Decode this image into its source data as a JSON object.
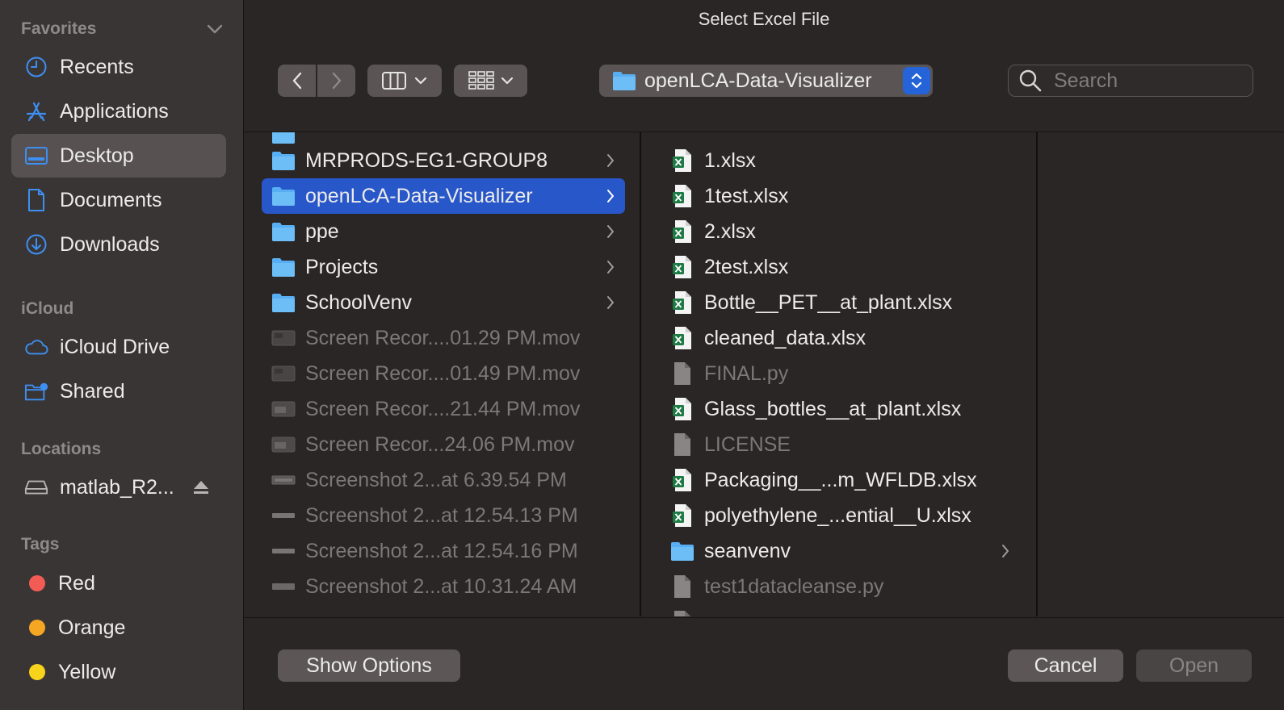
{
  "window": {
    "title": "Select Excel File"
  },
  "sidebar": {
    "sections": {
      "favorites": "Favorites",
      "icloud": "iCloud",
      "locations": "Locations",
      "tags": "Tags"
    },
    "favorites": [
      {
        "label": "Recents",
        "icon": "clock-icon"
      },
      {
        "label": "Applications",
        "icon": "applications-icon"
      },
      {
        "label": "Desktop",
        "icon": "desktop-icon",
        "selected": true
      },
      {
        "label": "Documents",
        "icon": "document-icon"
      },
      {
        "label": "Downloads",
        "icon": "download-icon"
      }
    ],
    "icloud": [
      {
        "label": "iCloud Drive",
        "icon": "cloud-icon"
      },
      {
        "label": "Shared",
        "icon": "shared-folder-icon"
      }
    ],
    "locations": [
      {
        "label": "matlab_R2...",
        "icon": "disk-icon"
      }
    ],
    "tags": [
      {
        "label": "Red",
        "color": "#f25c54"
      },
      {
        "label": "Orange",
        "color": "#f5a623"
      },
      {
        "label": "Yellow",
        "color": "#f8d31b"
      }
    ]
  },
  "toolbar": {
    "path": "openLCA-Data-Visualizer",
    "search_placeholder": "Search"
  },
  "column1": [
    {
      "name": "MRPRODS-EG1-GROUP8",
      "type": "folder"
    },
    {
      "name": "openLCA-Data-Visualizer",
      "type": "folder",
      "selected": true
    },
    {
      "name": "ppe",
      "type": "folder"
    },
    {
      "name": "Projects",
      "type": "folder"
    },
    {
      "name": "SchoolVenv",
      "type": "folder"
    },
    {
      "name": "Screen Recor....01.29 PM.mov",
      "type": "video",
      "dim": true
    },
    {
      "name": "Screen Recor....01.49 PM.mov",
      "type": "video",
      "dim": true
    },
    {
      "name": "Screen Recor....21.44 PM.mov",
      "type": "video",
      "dim": true
    },
    {
      "name": "Screen Recor...24.06 PM.mov",
      "type": "video",
      "dim": true
    },
    {
      "name": "Screenshot 2...at 6.39.54 PM",
      "type": "image",
      "dim": true
    },
    {
      "name": "Screenshot 2...at 12.54.13 PM",
      "type": "image",
      "dim": true
    },
    {
      "name": "Screenshot 2...at 12.54.16 PM",
      "type": "image",
      "dim": true
    },
    {
      "name": "Screenshot 2...at 10.31.24 AM",
      "type": "image",
      "dim": true
    }
  ],
  "column2": [
    {
      "name": "1.xlsx",
      "type": "xlsx"
    },
    {
      "name": "1test.xlsx",
      "type": "xlsx"
    },
    {
      "name": "2.xlsx",
      "type": "xlsx"
    },
    {
      "name": "2test.xlsx",
      "type": "xlsx"
    },
    {
      "name": "Bottle__PET__at_plant.xlsx",
      "type": "xlsx"
    },
    {
      "name": "cleaned_data.xlsx",
      "type": "xlsx"
    },
    {
      "name": "FINAL.py",
      "type": "doc",
      "dim": true
    },
    {
      "name": "Glass_bottles__at_plant.xlsx",
      "type": "xlsx"
    },
    {
      "name": "LICENSE",
      "type": "doc",
      "dim": true
    },
    {
      "name": "Packaging__...m_WFLDB.xlsx",
      "type": "xlsx"
    },
    {
      "name": "polyethylene_...ential__U.xlsx",
      "type": "xlsx"
    },
    {
      "name": "seanvenv",
      "type": "folder"
    },
    {
      "name": "test1datacleanse.py",
      "type": "doc",
      "dim": true
    }
  ],
  "buttons": {
    "show_options": "Show Options",
    "cancel": "Cancel",
    "open": "Open"
  }
}
